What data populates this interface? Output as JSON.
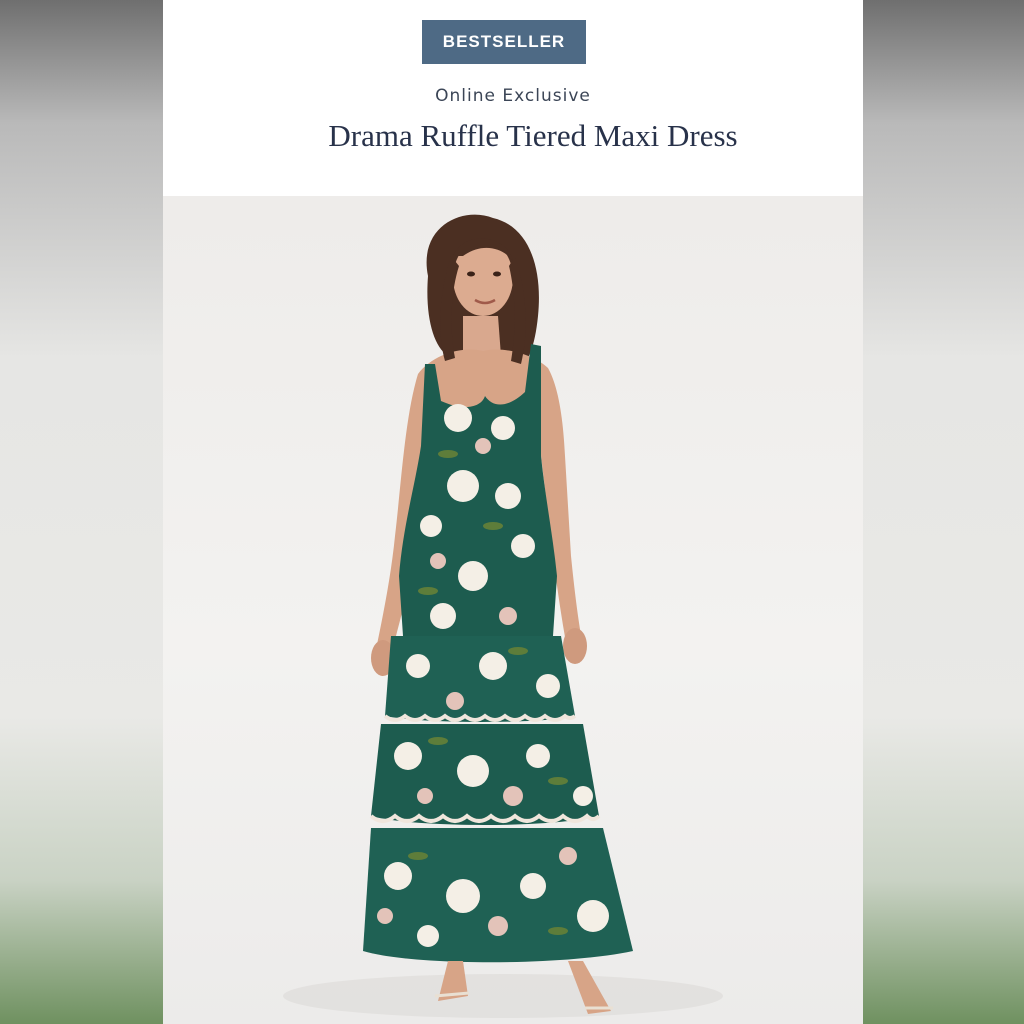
{
  "product": {
    "badge": "BESTSELLER",
    "eyebrow": "Online Exclusive",
    "title": "Drama Ruffle Tiered Maxi Dress"
  },
  "colors": {
    "badge_bg": "#4e6a85",
    "title_text": "#28324a",
    "dress_green": "#1d5c4f",
    "flower_white": "#f4efe6",
    "flower_pink": "#e3c3b9",
    "leaf_green": "#5e7d3a"
  },
  "image": {
    "semantic": "model-wearing-floral-tiered-maxi-dress"
  }
}
